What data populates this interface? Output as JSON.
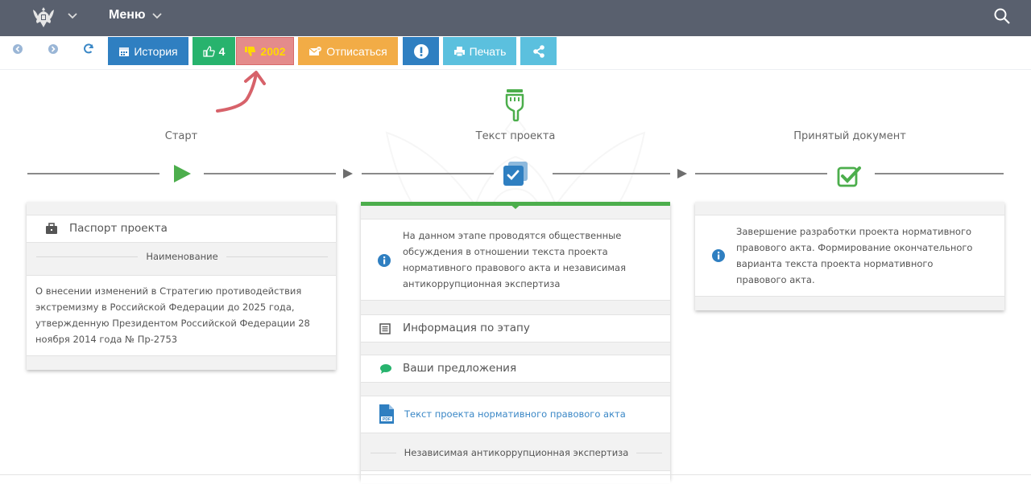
{
  "header": {
    "menu_label": "Меню"
  },
  "toolbar": {
    "history_label": "История",
    "likes_count": "4",
    "dislikes_count": "2002",
    "unsubscribe_label": "Отписаться",
    "print_label": "Печать"
  },
  "stages": {
    "start_label": "Старт",
    "project_text_label": "Текст проекта",
    "accepted_label": "Принятый документ"
  },
  "left_card": {
    "passport_label": "Паспорт проекта",
    "name_header": "Наименование",
    "name_text": "О внесении изменений в Стратегию противодействия экстремизму в Российской Федерации до 2025 года, утвержденную Президентом Российской Федерации 28 ноября 2014 года № Пр-2753"
  },
  "middle_card": {
    "info_text": "На данном этапе проводятся общественные обсуждения в отношении текста проекта нормативного правового акта и независимая антикоррупционная экспертиза",
    "stage_info_label": "Информация по этапу",
    "proposals_label": "Ваши предложения",
    "document_link": "Текст проекта нормативного правового акта",
    "expertise_header": "Независимая антикоррупционная экспертиза"
  },
  "right_card": {
    "info_text": "Завершение разработки проекта нормативного правового акта. Формирование окончательного варианта текста проекта нормативного правового акта."
  },
  "colors": {
    "topbar": "#59606e",
    "blue": "#2f7fc1",
    "green": "#27b36d",
    "dislike": "#e48b8b",
    "orange": "#f2ac46",
    "light_blue": "#5bc0de",
    "stage_green": "#4cae4c"
  }
}
